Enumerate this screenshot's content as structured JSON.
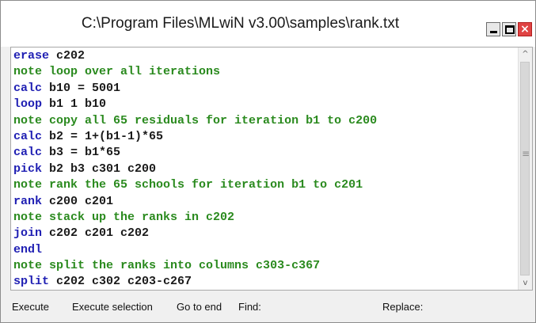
{
  "window": {
    "title": "C:\\Program Files\\MLwiN v3.00\\samples\\rank.txt",
    "controls": {
      "minimize": "minimize",
      "maximize": "maximize",
      "close": "×"
    }
  },
  "editor": {
    "lines": [
      {
        "kw": "erase",
        "rest": " c202",
        "comment": false
      },
      {
        "kw": "note",
        "rest": " loop over all iterations",
        "comment": true
      },
      {
        "kw": "calc",
        "rest": " b10 = 5001",
        "comment": false
      },
      {
        "kw": "loop",
        "rest": " b1 1 b10",
        "comment": false
      },
      {
        "kw": "note",
        "rest": " copy all 65 residuals for iteration b1 to c200",
        "comment": true
      },
      {
        "kw": "calc",
        "rest": " b2 = 1+(b1-1)*65",
        "comment": false
      },
      {
        "kw": "calc",
        "rest": " b3 = b1*65",
        "comment": false
      },
      {
        "kw": "pick",
        "rest": " b2 b3 c301 c200",
        "comment": false
      },
      {
        "kw": "note",
        "rest": " rank the 65 schools for iteration b1 to c201",
        "comment": true
      },
      {
        "kw": "rank",
        "rest": " c200 c201",
        "comment": false
      },
      {
        "kw": "note",
        "rest": " stack up the ranks in c202",
        "comment": true
      },
      {
        "kw": "join",
        "rest": " c202 c201 c202",
        "comment": false
      },
      {
        "kw": "endl",
        "rest": "",
        "comment": false
      },
      {
        "kw": "note",
        "rest": " split the ranks into columns c303-c367",
        "comment": true
      },
      {
        "kw": "split",
        "rest": " c202 c302 c203-c267",
        "comment": false
      }
    ],
    "scrollbar": {
      "up": "^",
      "down": "v",
      "grip": "≡"
    }
  },
  "toolbar": {
    "execute": "Execute",
    "execute_selection": "Execute selection",
    "go_to_end": "Go to end",
    "find": "Find:",
    "replace": "Replace:"
  },
  "colors": {
    "keyword": "#1f1fb3",
    "comment": "#2a8a1e",
    "close_button": "#e04343"
  }
}
